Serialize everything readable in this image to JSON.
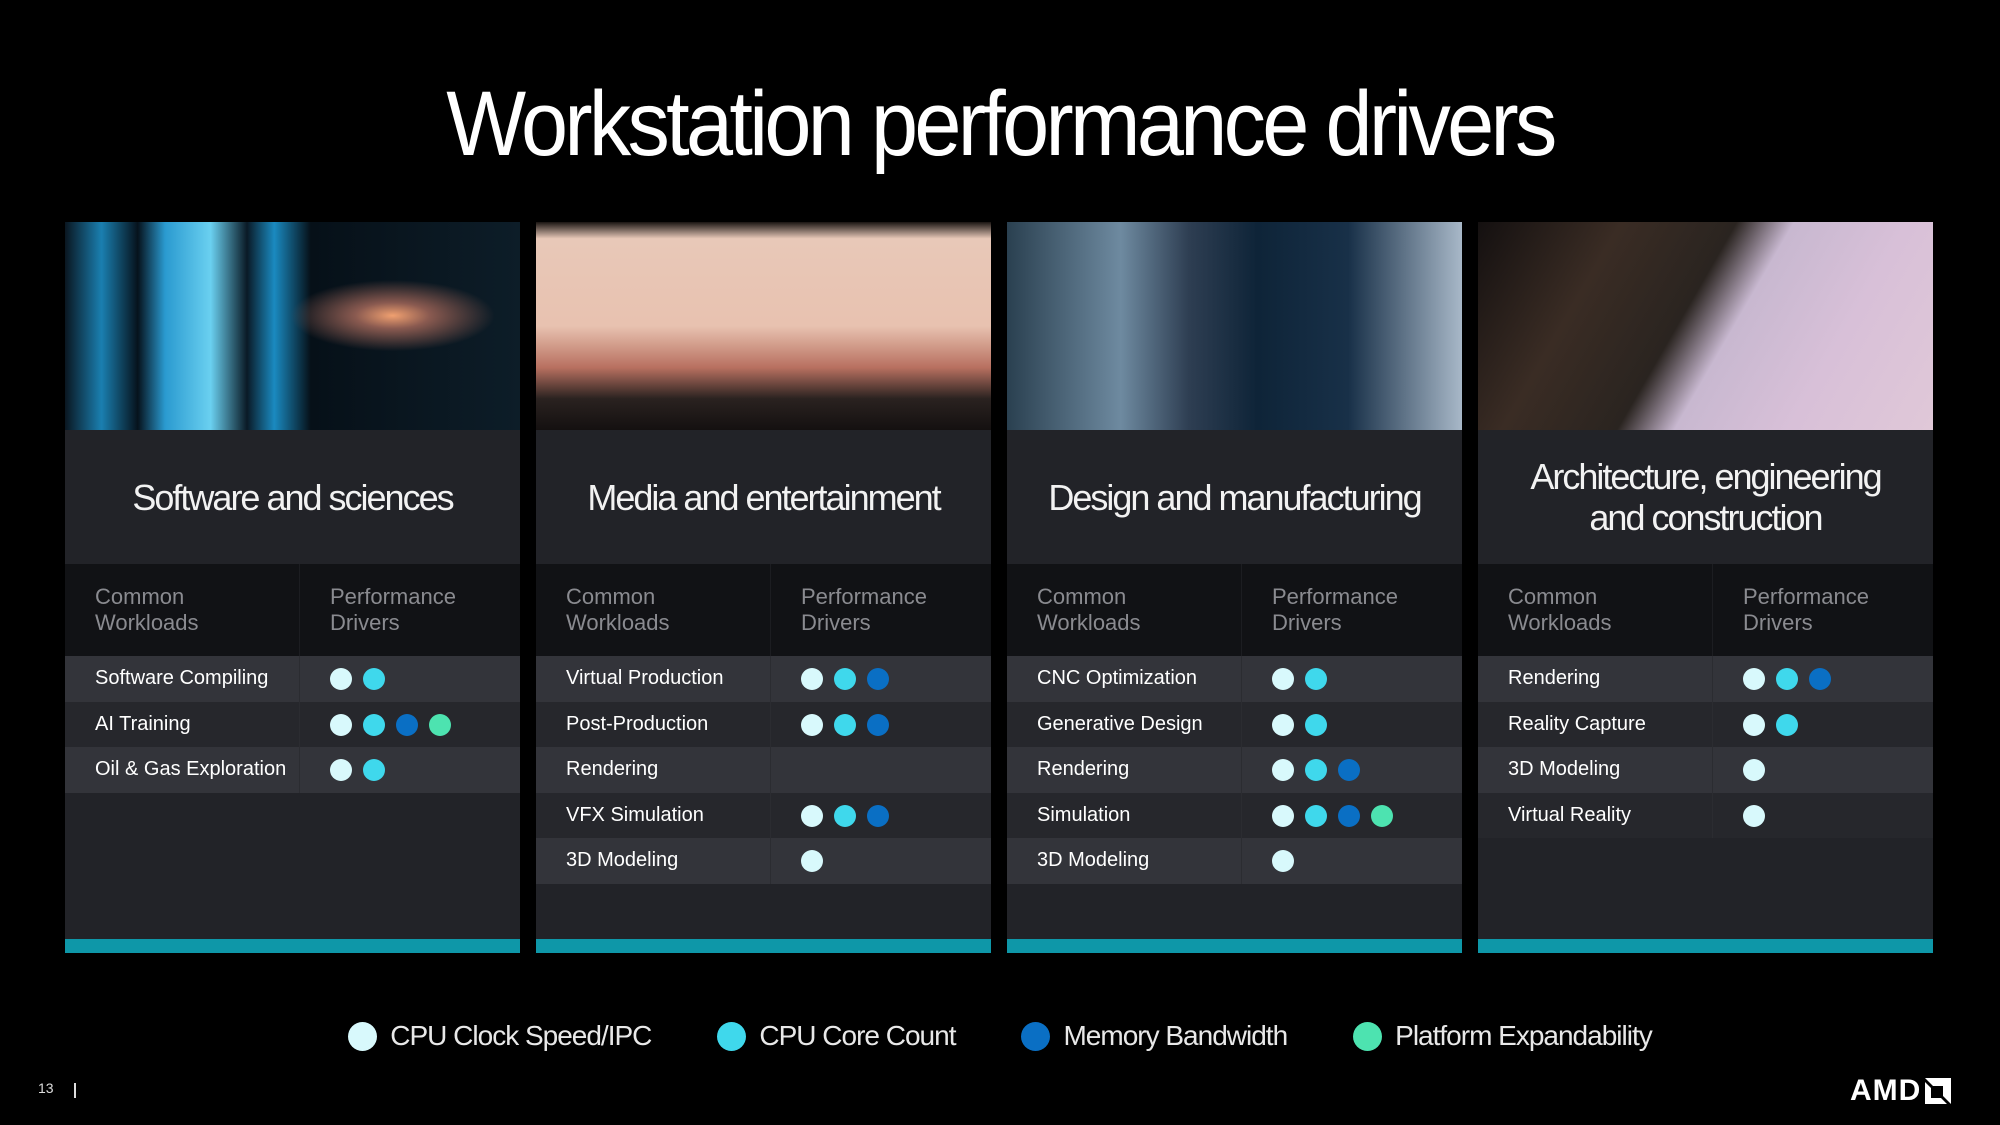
{
  "title": "Workstation performance drivers",
  "column_headers": {
    "workloads": "Common\nWorkloads",
    "drivers": "Performance\nDrivers"
  },
  "drivers": {
    "clock": {
      "label": "CPU Clock Speed/IPC",
      "color": "#d8f9fc"
    },
    "cores": {
      "label": "CPU Core Count",
      "color": "#3fd8ec"
    },
    "memory": {
      "label": "Memory Bandwidth",
      "color": "#0a6fc4"
    },
    "platform": {
      "label": "Platform Expandability",
      "color": "#4de3b0"
    }
  },
  "legend_order": [
    "clock",
    "cores",
    "memory",
    "platform"
  ],
  "cards": [
    {
      "category": "Software and sciences",
      "image": "person-viewing-code-screens",
      "workloads": [
        {
          "name": "Software Compiling",
          "drivers": [
            "clock",
            "cores"
          ]
        },
        {
          "name": "AI Training",
          "drivers": [
            "clock",
            "cores",
            "memory",
            "platform"
          ]
        },
        {
          "name": "Oil & Gas Exploration",
          "drivers": [
            "clock",
            "cores"
          ]
        }
      ]
    },
    {
      "category": "Media and entertainment",
      "image": "virtual-production-stage",
      "workloads": [
        {
          "name": "Virtual Production",
          "drivers": [
            "clock",
            "cores",
            "memory"
          ]
        },
        {
          "name": "Post-Production",
          "drivers": [
            "clock",
            "cores",
            "memory"
          ]
        },
        {
          "name": "Rendering",
          "drivers": []
        },
        {
          "name": "VFX Simulation",
          "drivers": [
            "clock",
            "cores",
            "memory"
          ]
        },
        {
          "name": "3D Modeling",
          "drivers": [
            "clock"
          ]
        }
      ]
    },
    {
      "category": "Design and manufacturing",
      "image": "engineer-at-dual-monitors",
      "workloads": [
        {
          "name": "CNC Optimization",
          "drivers": [
            "clock",
            "cores"
          ]
        },
        {
          "name": "Generative Design",
          "drivers": [
            "clock",
            "cores"
          ]
        },
        {
          "name": "Rendering",
          "drivers": [
            "clock",
            "cores",
            "memory"
          ]
        },
        {
          "name": "Simulation",
          "drivers": [
            "clock",
            "cores",
            "memory",
            "platform"
          ]
        },
        {
          "name": "3D Modeling",
          "drivers": [
            "clock"
          ]
        }
      ]
    },
    {
      "category": "Architecture, engineering and construction",
      "image": "construction-crane",
      "workloads": [
        {
          "name": "Rendering",
          "drivers": [
            "clock",
            "cores",
            "memory"
          ]
        },
        {
          "name": "Reality Capture",
          "drivers": [
            "clock",
            "cores"
          ]
        },
        {
          "name": "3D Modeling",
          "drivers": [
            "clock"
          ]
        },
        {
          "name": "Virtual Reality",
          "drivers": [
            "clock"
          ]
        }
      ]
    }
  ],
  "footer": {
    "page_number": "13",
    "logo_text": "AMD",
    "logo_icon": "amd-arrow-icon"
  },
  "accent_bar_color": "#0e97a8"
}
